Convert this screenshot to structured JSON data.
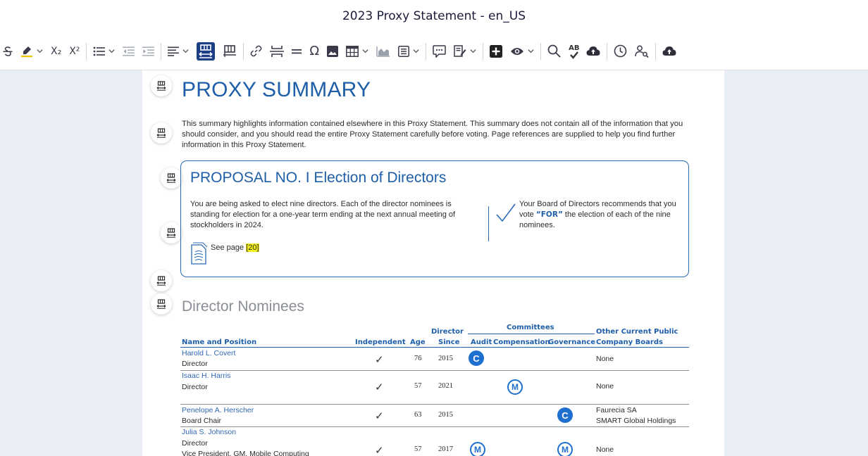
{
  "window": {
    "title": "2023 Proxy Statement - en_US"
  },
  "toolbar": {
    "icons": [
      "strikethrough-icon",
      "highlighter-icon",
      "subscript-icon",
      "superscript-icon",
      "bullet-list-icon",
      "outdent-icon",
      "indent-icon",
      "align-icon",
      "fit-width-icon",
      "page-layout-icon",
      "link-icon",
      "page-break-icon",
      "horizontal-rule-icon",
      "omega-icon",
      "image-icon",
      "table-icon",
      "chart-icon",
      "snippet-icon",
      "comment-icon",
      "track-changes-icon",
      "add-block-icon",
      "preview-icon",
      "search-icon",
      "spellcheck-icon",
      "cloud-upload-icon",
      "history-icon",
      "find-replace-icon",
      "cloud-download-icon"
    ],
    "subscript_label": "X₂",
    "superscript_label": "X²",
    "spellcheck_label": "AB"
  },
  "document": {
    "heading": "PROXY SUMMARY",
    "intro": "This summary highlights information contained elsewhere in this Proxy Statement. This summary does not contain all of the information that you should consider, and you should read the entire Proxy Statement carefully before voting. Page references are supplied to help you find further information in this Proxy Statement.",
    "proposal": {
      "title": "PROPOSAL NO. I Election of Directors",
      "text": "You are being asked to elect nine directors. Each of the director nominees is standing for election for a one-year term ending at the next annual meeting of stockholders in 2024.",
      "recommend_pre": "Your Board of Directors recommends that you vote ",
      "recommend_for": "“FOR”",
      "recommend_post": " the election of each of the nine nominees.",
      "see_page": "See page ",
      "page_ref": "[20]"
    },
    "nominees": {
      "heading": "Director Nominees",
      "headers": {
        "name": "Name and Position",
        "independent": "Independent",
        "age": "Age",
        "director_since_1": "Director",
        "director_since_2": "Since",
        "committees": "Committees",
        "audit": "Audit",
        "compensation": "Compensation",
        "governance": "Governance",
        "other_boards_1": "Other Current Public",
        "other_boards_2": "Company Boards"
      },
      "rows": [
        {
          "name": "Harold L. Covert",
          "position": "Director",
          "position2": "",
          "independent": "✓",
          "age": "76",
          "since": "2015",
          "audit": "C",
          "compensation": "",
          "governance": "",
          "boards": "None",
          "boards2": ""
        },
        {
          "name": "Isaac H. Harris",
          "position": "Director",
          "position2": "",
          "independent": "✓",
          "age": "57",
          "since": "2021",
          "audit": "",
          "compensation": "M",
          "governance": "",
          "boards": "None",
          "boards2": ""
        },
        {
          "name": "Penelope A. Herscher",
          "position": "Board Chair",
          "position2": "",
          "independent": "✓",
          "age": "63",
          "since": "2015",
          "audit": "",
          "compensation": "",
          "governance": "C",
          "boards": "Faurecia SA",
          "boards2": "SMART Global Holdings"
        },
        {
          "name": "Julia S. Johnson",
          "position": "Director",
          "position2": "Vice President, GM, Mobile Computing",
          "independent": "✓",
          "age": "57",
          "since": "2017",
          "audit": "M",
          "compensation": "",
          "governance": "M",
          "boards": "None",
          "boards2": ""
        }
      ]
    }
  },
  "colors": {
    "heading_blue": "#1f5ea8",
    "badge_blue": "#1f6fd0",
    "highlight": "#f2ef1a",
    "active_tool": "#1b3f86"
  }
}
